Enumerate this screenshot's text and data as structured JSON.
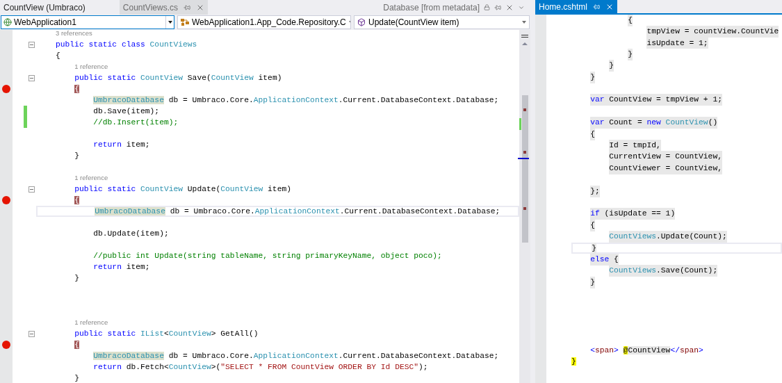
{
  "left_pane": {
    "tabs": [
      {
        "label": "CountView (Umbraco)",
        "selected": false
      },
      {
        "label": "CountViews.cs",
        "selected": true
      }
    ],
    "preview_tab": {
      "label": "Database [from metadata]"
    },
    "navigation": {
      "project": "WebApplication1",
      "type": "WebApplication1.App_Code.Repository.C",
      "member": "Update(CountView item)"
    },
    "lines": [
      {
        "kind": "lens",
        "text": "3 references"
      },
      {
        "kind": "code",
        "fold": true,
        "tokens": [
          {
            "text": "public static class ",
            "kind": "k"
          },
          {
            "text": "CountViews",
            "kind": "t"
          }
        ]
      },
      {
        "kind": "code",
        "tokens": [
          {
            "text": "{",
            "kind": "p"
          }
        ]
      },
      {
        "kind": "lens",
        "text": "    1 reference"
      },
      {
        "kind": "code",
        "fold": true,
        "tokens": [
          {
            "text": "    public static ",
            "kind": "k"
          },
          {
            "text": "CountView",
            "kind": "t"
          },
          {
            "text": " Save(",
            "kind": "p"
          },
          {
            "text": "CountView",
            "kind": "t"
          },
          {
            "text": " item)",
            "kind": "p"
          }
        ]
      },
      {
        "kind": "code",
        "breakpoint": true,
        "tokens": [
          {
            "text": "    {",
            "kind": "b"
          }
        ]
      },
      {
        "kind": "code",
        "tokens": [
          {
            "text": "        UmbracoDatabase",
            "kind": "r"
          },
          {
            "text": " db = Umbraco.Core.",
            "kind": "p"
          },
          {
            "text": "ApplicationContext",
            "kind": "t"
          },
          {
            "text": ".Current.DatabaseContext.Database;",
            "kind": "p"
          }
        ]
      },
      {
        "kind": "code",
        "changed": true,
        "tokens": [
          {
            "text": "        db.Save(item);",
            "kind": "p"
          }
        ]
      },
      {
        "kind": "code",
        "changed": true,
        "tokens": [
          {
            "text": "        //db.Insert(item);",
            "kind": "c"
          }
        ]
      },
      {
        "kind": "blank"
      },
      {
        "kind": "code",
        "tokens": [
          {
            "text": "        return",
            "kind": "k"
          },
          {
            "text": " item;",
            "kind": "p"
          }
        ]
      },
      {
        "kind": "code",
        "tokens": [
          {
            "text": "    }",
            "kind": "p"
          }
        ]
      },
      {
        "kind": "blank"
      },
      {
        "kind": "lens",
        "text": "    1 reference"
      },
      {
        "kind": "code",
        "fold": true,
        "tokens": [
          {
            "text": "    public static ",
            "kind": "k"
          },
          {
            "text": "CountView",
            "kind": "t"
          },
          {
            "text": " Update(",
            "kind": "p"
          },
          {
            "text": "CountView",
            "kind": "t"
          },
          {
            "text": " item)",
            "kind": "p"
          }
        ]
      },
      {
        "kind": "code",
        "breakpoint": true,
        "tokens": [
          {
            "text": "    {",
            "kind": "b"
          }
        ]
      },
      {
        "kind": "code",
        "current": true,
        "tokens": [
          {
            "text": "        UmbracoDatabase",
            "kind": "r"
          },
          {
            "text": " db = Umbraco.Core.",
            "kind": "p"
          },
          {
            "text": "ApplicationContext",
            "kind": "t"
          },
          {
            "text": ".Current.DatabaseContext.Database;",
            "kind": "p"
          }
        ]
      },
      {
        "kind": "blank"
      },
      {
        "kind": "code",
        "tokens": [
          {
            "text": "        db.Update(item);",
            "kind": "p"
          }
        ]
      },
      {
        "kind": "blank"
      },
      {
        "kind": "code",
        "tokens": [
          {
            "text": "        //public int Update(string tableName, string primaryKeyName, object poco);",
            "kind": "c"
          }
        ]
      },
      {
        "kind": "code",
        "tokens": [
          {
            "text": "        return",
            "kind": "k"
          },
          {
            "text": " item;",
            "kind": "p"
          }
        ]
      },
      {
        "kind": "code",
        "tokens": [
          {
            "text": "    }",
            "kind": "p"
          }
        ]
      },
      {
        "kind": "blank"
      },
      {
        "kind": "blank"
      },
      {
        "kind": "blank"
      },
      {
        "kind": "lens",
        "text": "    1 reference"
      },
      {
        "kind": "code",
        "fold": true,
        "tokens": [
          {
            "text": "    public static ",
            "kind": "k"
          },
          {
            "text": "IList",
            "kind": "t"
          },
          {
            "text": "<",
            "kind": "p"
          },
          {
            "text": "CountView",
            "kind": "t"
          },
          {
            "text": "> GetAll()",
            "kind": "p"
          }
        ]
      },
      {
        "kind": "code",
        "breakpoint": true,
        "tokens": [
          {
            "text": "    {",
            "kind": "b"
          }
        ]
      },
      {
        "kind": "code",
        "tokens": [
          {
            "text": "        UmbracoDatabase",
            "kind": "r"
          },
          {
            "text": " db = Umbraco.Core.",
            "kind": "p"
          },
          {
            "text": "ApplicationContext",
            "kind": "t"
          },
          {
            "text": ".Current.DatabaseContext.Database;",
            "kind": "p"
          }
        ]
      },
      {
        "kind": "code",
        "tokens": [
          {
            "text": "        return",
            "kind": "k"
          },
          {
            "text": " db.Fetch<",
            "kind": "p"
          },
          {
            "text": "CountView",
            "kind": "t"
          },
          {
            "text": ">(",
            "kind": "p"
          },
          {
            "text": "\"SELECT * FROM CountView ORDER BY Id DESC\"",
            "kind": "s"
          },
          {
            "text": ");",
            "kind": "p"
          }
        ]
      },
      {
        "kind": "code",
        "tokens": [
          {
            "text": "    }",
            "kind": "p"
          }
        ]
      }
    ]
  },
  "right_pane": {
    "tabs": [
      {
        "label": "Home.cshtml",
        "selected": true
      }
    ],
    "lines": [
      {
        "kind": "code",
        "razor": true,
        "tokens": [
          {
            "text": "            {",
            "kind": "p"
          }
        ]
      },
      {
        "kind": "code",
        "razor": true,
        "tokens": [
          {
            "text": "                tmpView = countView.CountVie",
            "kind": "p"
          }
        ]
      },
      {
        "kind": "code",
        "razor": true,
        "tokens": [
          {
            "text": "                isUpdate = 1;",
            "kind": "p"
          }
        ]
      },
      {
        "kind": "code",
        "razor": true,
        "tokens": [
          {
            "text": "            }",
            "kind": "p"
          }
        ]
      },
      {
        "kind": "code",
        "razor": true,
        "tokens": [
          {
            "text": "        }",
            "kind": "p"
          }
        ]
      },
      {
        "kind": "code",
        "razor": true,
        "tokens": [
          {
            "text": "    }",
            "kind": "p"
          }
        ]
      },
      {
        "kind": "blank"
      },
      {
        "kind": "code",
        "razor": true,
        "tokens": [
          {
            "text": "    var",
            "kind": "k"
          },
          {
            "text": " CountView = tmpView + 1;",
            "kind": "p"
          }
        ]
      },
      {
        "kind": "blank"
      },
      {
        "kind": "code",
        "razor": true,
        "tokens": [
          {
            "text": "    var",
            "kind": "k"
          },
          {
            "text": " Count = ",
            "kind": "p"
          },
          {
            "text": "new ",
            "kind": "k"
          },
          {
            "text": "CountView",
            "kind": "t"
          },
          {
            "text": "()",
            "kind": "p"
          }
        ]
      },
      {
        "kind": "code",
        "razor": true,
        "tokens": [
          {
            "text": "    {",
            "kind": "p"
          }
        ]
      },
      {
        "kind": "code",
        "razor": true,
        "tokens": [
          {
            "text": "        Id = tmpId,",
            "kind": "p"
          }
        ]
      },
      {
        "kind": "code",
        "razor": true,
        "tokens": [
          {
            "text": "        CurrentView = CountView,",
            "kind": "p"
          }
        ]
      },
      {
        "kind": "code",
        "razor": true,
        "tokens": [
          {
            "text": "        CountViewer = CountView,",
            "kind": "p"
          }
        ]
      },
      {
        "kind": "blank"
      },
      {
        "kind": "code",
        "razor": true,
        "tokens": [
          {
            "text": "    };",
            "kind": "p"
          }
        ]
      },
      {
        "kind": "blank"
      },
      {
        "kind": "code",
        "razor": true,
        "tokens": [
          {
            "text": "    if",
            "kind": "k"
          },
          {
            "text": " (isUpdate == 1)",
            "kind": "p"
          }
        ]
      },
      {
        "kind": "code",
        "razor": true,
        "tokens": [
          {
            "text": "    {",
            "kind": "p"
          }
        ]
      },
      {
        "kind": "code",
        "razor": true,
        "tokens": [
          {
            "text": "        CountViews",
            "kind": "t"
          },
          {
            "text": ".Update(Count);",
            "kind": "p"
          }
        ]
      },
      {
        "kind": "code",
        "razor": true,
        "current": true,
        "tokens": [
          {
            "text": "    }",
            "kind": "p"
          }
        ]
      },
      {
        "kind": "code",
        "razor": true,
        "tokens": [
          {
            "text": "    else",
            "kind": "k"
          },
          {
            "text": " {",
            "kind": "p"
          }
        ]
      },
      {
        "kind": "code",
        "razor": true,
        "tokens": [
          {
            "text": "        CountViews",
            "kind": "t"
          },
          {
            "text": ".Save(Count);",
            "kind": "p"
          }
        ]
      },
      {
        "kind": "code",
        "razor": true,
        "tokens": [
          {
            "text": "    }",
            "kind": "p"
          }
        ]
      },
      {
        "kind": "blank"
      },
      {
        "kind": "blank"
      },
      {
        "kind": "blank"
      },
      {
        "kind": "blank"
      },
      {
        "kind": "blank"
      },
      {
        "kind": "code",
        "tokens": [
          {
            "text": "    <",
            "kind": "h"
          },
          {
            "text": "span",
            "kind": "tag"
          },
          {
            "text": "> ",
            "kind": "h"
          },
          {
            "text": "@",
            "kind": "y"
          },
          {
            "text": "CountView",
            "kind": "g"
          },
          {
            "text": "</",
            "kind": "h"
          },
          {
            "text": "span",
            "kind": "tag"
          },
          {
            "text": ">",
            "kind": "h"
          }
        ]
      },
      {
        "kind": "code",
        "tokens": [
          {
            "text": "}",
            "kind": "y"
          }
        ]
      }
    ]
  }
}
